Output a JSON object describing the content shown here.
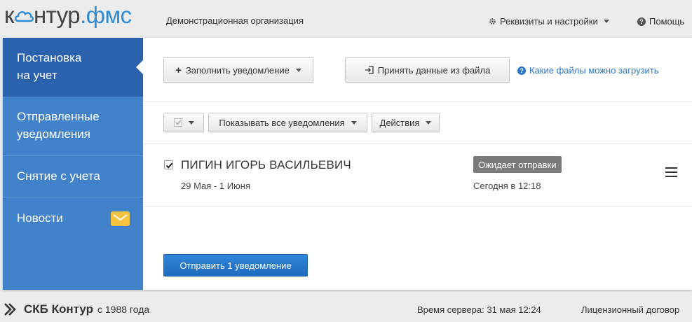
{
  "header": {
    "logo_part1": "к",
    "logo_part2": "нтур",
    "logo_part3": ".фмс",
    "organization": "Демонстрационная организация",
    "settings_label": "Реквизиты и настройки",
    "help_label": "Помощь"
  },
  "sidebar": {
    "items": [
      {
        "label_line1": "Постановка",
        "label_line2": "на учет",
        "active": true
      },
      {
        "label_line1": "Отправленные",
        "label_line2": "уведомления",
        "active": false
      },
      {
        "label_line1": "Снятие с учета",
        "label_line2": "",
        "active": false
      },
      {
        "label_line1": "Новости",
        "label_line2": "",
        "active": false
      }
    ]
  },
  "toolbar": {
    "fill_label": "Заполнить уведомление",
    "import_label": "Принять данные из файла",
    "files_link": "Какие файлы можно загрузить",
    "filter_label": "Показывать все уведомления",
    "actions_label": "Действия"
  },
  "notifications": [
    {
      "name": "ПИГИН ИГОРЬ ВАСИЛЬЕВИЧ",
      "dates": "29 Мая - 1 Июня",
      "status": "Ожидает отправки",
      "time": "Сегодня в 12:18",
      "checked": true
    }
  ],
  "send_button": "Отправить 1 уведомление",
  "footer": {
    "company": "СКБ Контур",
    "since": "с 1988 года",
    "server_time": "Время сервера: 31 мая 12:24",
    "license": "Лицензионный договор"
  },
  "colors": {
    "sidebar": "#4282ca",
    "sidebar_active": "#2a62ad",
    "primary_button": "#2478c9",
    "status_badge": "#7a7a7a",
    "link": "#2e77c5"
  }
}
